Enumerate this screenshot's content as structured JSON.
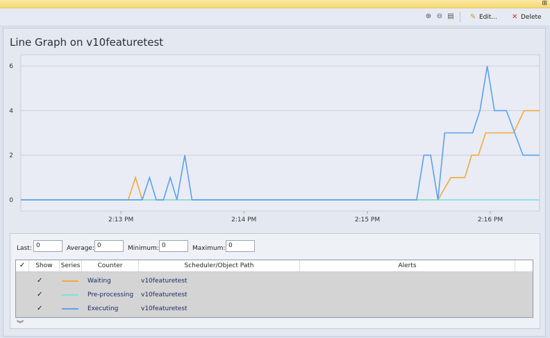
{
  "toolbar": {
    "zoom_in_icon": "magnifier-plus-icon",
    "zoom_out_icon": "magnifier-minus-icon",
    "print_icon": "printer-icon",
    "edit_label": "Edit...",
    "delete_label": "Delete"
  },
  "page_title": "Line Graph on v10featuretest",
  "chart_data": {
    "type": "line",
    "y_ticks": [
      "0",
      "2",
      "4",
      "6"
    ],
    "x_ticks": [
      "2:13 PM",
      "2:14 PM",
      "2:15 PM",
      "2:16 PM"
    ],
    "ylim": [
      -0.5,
      6.5
    ],
    "xlim": [
      0,
      100
    ],
    "x_tick_positions": [
      19.3,
      43.0,
      66.8,
      90.5
    ],
    "grid": true,
    "series": [
      {
        "name": "Waiting",
        "color": "#f5a83a",
        "points": [
          [
            0,
            0
          ],
          [
            20.7,
            0
          ],
          [
            22.1,
            1
          ],
          [
            23.4,
            0
          ],
          [
            80.4,
            0
          ],
          [
            82.9,
            1
          ],
          [
            85.6,
            1
          ],
          [
            86.9,
            2
          ],
          [
            88.2,
            2
          ],
          [
            89.6,
            3
          ],
          [
            95.0,
            3
          ],
          [
            97.0,
            4
          ],
          [
            100,
            4
          ]
        ]
      },
      {
        "name": "Pre-processing",
        "color": "#7fe0e0",
        "points": [
          [
            0,
            0
          ],
          [
            100,
            0
          ]
        ]
      },
      {
        "name": "Executing",
        "color": "#5aa0f0",
        "points": [
          [
            0,
            0
          ],
          [
            23.4,
            0
          ],
          [
            24.8,
            1
          ],
          [
            26.1,
            0
          ],
          [
            27.5,
            0
          ],
          [
            28.8,
            1
          ],
          [
            30.1,
            0
          ],
          [
            31.6,
            2
          ],
          [
            33.0,
            0
          ],
          [
            76.3,
            0
          ],
          [
            77.7,
            2
          ],
          [
            79.0,
            2
          ],
          [
            80.4,
            0
          ],
          [
            81.7,
            3
          ],
          [
            87.1,
            3
          ],
          [
            88.5,
            4
          ],
          [
            89.9,
            6
          ],
          [
            91.3,
            4
          ],
          [
            93.6,
            4
          ],
          [
            96.8,
            2
          ],
          [
            100,
            2
          ]
        ]
      }
    ]
  },
  "stats": {
    "last_label": "Last:",
    "last_value": "0",
    "average_label": "Average:",
    "average_value": "0",
    "minimum_label": "Minimum:",
    "minimum_value": "0",
    "maximum_label": "Maximum:",
    "maximum_value": "0"
  },
  "grid": {
    "headers": {
      "show": "Show",
      "series": "Series",
      "counter": "Counter",
      "path": "Scheduler/Object Path",
      "alerts": "Alerts"
    },
    "header_check": "✓",
    "rows": [
      {
        "check": "✓",
        "counter": "Waiting",
        "path": "v10featuretest",
        "color": "#f5a83a"
      },
      {
        "check": "✓",
        "counter": "Pre-processing",
        "path": "v10featuretest",
        "color": "#7fe0e0"
      },
      {
        "check": "✓",
        "counter": "Executing",
        "path": "v10featuretest",
        "color": "#5aa0f0"
      }
    ]
  },
  "expand_icon": "double-chevron-down-icon"
}
